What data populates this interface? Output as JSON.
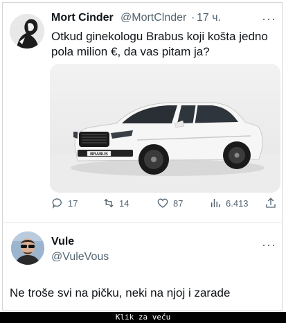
{
  "tweet": {
    "author_name": "Mort Cinder",
    "author_handle": "@MortClnder",
    "separator": "·",
    "time": "17 ч.",
    "more": "···",
    "text_line1": "Otkud ginekologu Brabus koji košta jedno",
    "text_line2": "pola milion €, da vas pitam ja?",
    "image_badge": "BRABUS",
    "actions": {
      "replies": "17",
      "retweets": "14",
      "likes": "87",
      "views": "6.413"
    }
  },
  "reply": {
    "author_name": "Vule",
    "author_handle": "@VuleVous",
    "more": "···",
    "text": "Ne troše svi na pičku, neki na njoj i zarade"
  },
  "footer": {
    "label": "Klik za veću"
  },
  "colors": {
    "text": "#0f1419",
    "muted": "#536471",
    "car": "#f3f3f3"
  }
}
